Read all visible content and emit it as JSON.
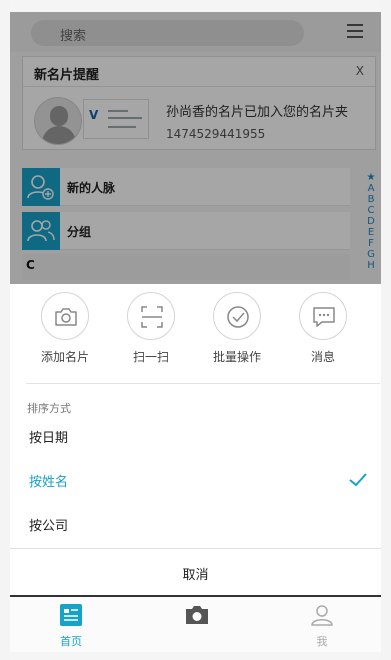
{
  "search": {
    "placeholder": "搜索"
  },
  "reminder": {
    "title": "新名片提醒",
    "close": "X",
    "message": "孙尚香的名片已加入您的名片夹",
    "phone": "1474529441955"
  },
  "contacts": {
    "new_contacts": "新的人脉",
    "groups": "分组",
    "section_letter": "C"
  },
  "index_letters": [
    "★",
    "A",
    "B",
    "C",
    "D",
    "E",
    "F",
    "G",
    "H"
  ],
  "actions": [
    {
      "label": "添加名片",
      "icon": "camera-icon"
    },
    {
      "label": "扫一扫",
      "icon": "scan-icon"
    },
    {
      "label": "批量操作",
      "icon": "check-circle-icon"
    },
    {
      "label": "消息",
      "icon": "message-icon"
    }
  ],
  "sort": {
    "label": "排序方式",
    "options": [
      "按日期",
      "按姓名",
      "按公司"
    ],
    "selected": "按姓名"
  },
  "cancel_label": "取消",
  "nav": {
    "home": "首页",
    "me": "我"
  },
  "colors": {
    "accent": "#17a2c9"
  }
}
